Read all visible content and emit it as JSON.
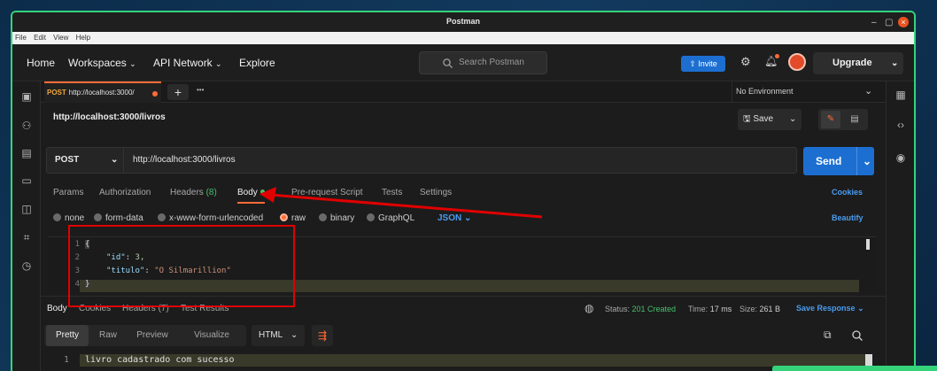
{
  "window": {
    "title": "Postman"
  },
  "menubar": [
    "File",
    "Edit",
    "View",
    "Help"
  ],
  "header": {
    "nav": [
      "Home",
      "Workspaces",
      "API Network",
      "Explore"
    ],
    "search_placeholder": "Search Postman",
    "invite_label": "Invite",
    "upgrade_label": "Upgrade"
  },
  "tabs": {
    "active": {
      "method": "POST",
      "label": "http://localhost:3000/"
    },
    "plus": "+",
    "more": "•••",
    "environment": "No Environment"
  },
  "request": {
    "title": "http://localhost:3000/livros",
    "save_label": "Save",
    "method": "POST",
    "url": "http://localhost:3000/livros",
    "send_label": "Send",
    "tabs": [
      {
        "label": "Params"
      },
      {
        "label": "Authorization"
      },
      {
        "label": "Headers",
        "count": "(8)"
      },
      {
        "label": "Body"
      },
      {
        "label": "Pre-request Script"
      },
      {
        "label": "Tests"
      },
      {
        "label": "Settings"
      }
    ],
    "cookies_label": "Cookies",
    "body_types": [
      "none",
      "form-data",
      "x-www-form-urlencoded",
      "raw",
      "binary",
      "GraphQL"
    ],
    "format": "JSON",
    "beautify_label": "Beautify",
    "lines": [
      "1",
      "2",
      "3",
      "4"
    ],
    "code": [
      "{",
      "\"id\"",
      "3,",
      "\"titulo\"",
      "\"O Silmarillion\"",
      "}"
    ]
  },
  "response": {
    "tabs": [
      "Body",
      "Cookies",
      "Headers (7)",
      "Test Results"
    ],
    "status_label": "Status:",
    "status_value": "201 Created",
    "time_label": "Time:",
    "time_value": "17 ms",
    "size_label": "Size:",
    "size_value": "261 B",
    "save_label": "Save Response",
    "views": [
      "Pretty",
      "Raw",
      "Preview",
      "Visualize"
    ],
    "format": "HTML",
    "line": "1",
    "body_text": "livro cadastrado com sucesso"
  },
  "colors": {
    "accent": "#ff6c37",
    "primary": "#1c6fd1",
    "success": "#45c06b",
    "annotation": "#e00000"
  }
}
